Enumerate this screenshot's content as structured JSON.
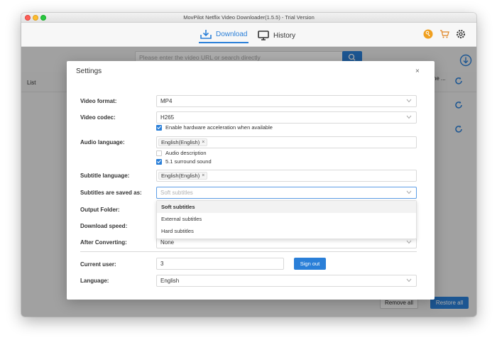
{
  "window": {
    "title": "MovPilot Netflix Video Downloader(1.5.5) - Trial Version"
  },
  "header": {
    "tabs": [
      {
        "label": "Download"
      },
      {
        "label": "History"
      }
    ]
  },
  "search": {
    "placeholder": "Please enter the video URL or search directly"
  },
  "list": {
    "column_label": "List",
    "column_right": "The ..."
  },
  "footer": {
    "remove_all": "Remove all",
    "restore_all": "Restore all"
  },
  "settings": {
    "title": "Settings",
    "close": "×",
    "video_format": {
      "label": "Video format:",
      "value": "MP4"
    },
    "video_codec": {
      "label": "Video codec:",
      "value": "H265"
    },
    "hw_accel": {
      "label": "Enable hardware acceleration when available",
      "checked": true
    },
    "audio_language": {
      "label": "Audio language:",
      "tag": "English(English)"
    },
    "audio_description": {
      "label": "Audio description",
      "checked": false
    },
    "surround": {
      "label": "5.1 surround sound",
      "checked": true
    },
    "subtitle_language": {
      "label": "Subtitle language:",
      "tag": "English(English)"
    },
    "subtitles_saved_as": {
      "label": "Subtitles are saved as:",
      "placeholder": "Soft subtitles"
    },
    "output_folder": {
      "label": "Output Folder:"
    },
    "download_speed": {
      "label": "Download speed:"
    },
    "after_converting": {
      "label": "After Converting:",
      "value": "None"
    },
    "current_user": {
      "label": "Current user:",
      "value": "3",
      "sign_out": "Sign out"
    },
    "language": {
      "label": "Language:",
      "value": "English"
    },
    "dropdown_options": [
      "Soft subtitles",
      "External subtitles",
      "Hard subtitles"
    ],
    "tag_remove": "×"
  },
  "colors": {
    "accent": "#2a7fd8",
    "key_icon": "#f0a020"
  }
}
